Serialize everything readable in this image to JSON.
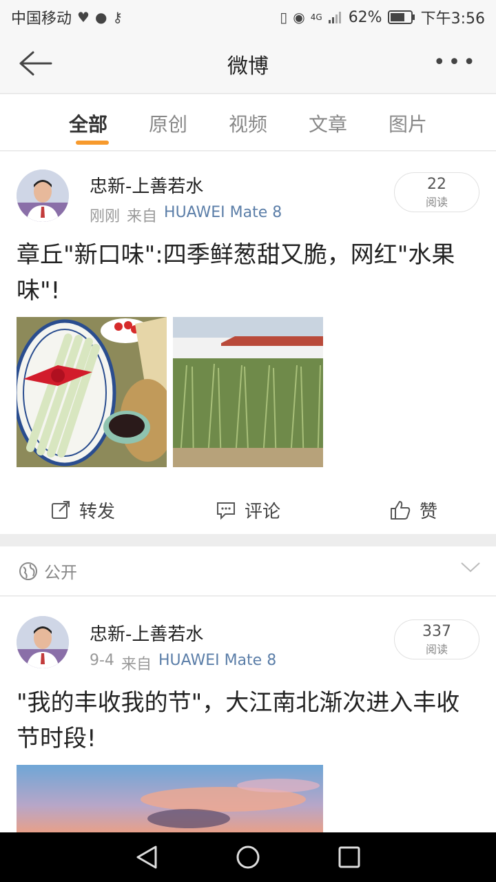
{
  "status_bar": {
    "carrier": "中国移动",
    "network": "4G",
    "battery": "62%",
    "time": "下午3:56"
  },
  "header": {
    "title": "微博"
  },
  "tabs": [
    {
      "label": "全部",
      "active": true
    },
    {
      "label": "原创",
      "active": false
    },
    {
      "label": "视频",
      "active": false
    },
    {
      "label": "文章",
      "active": false
    },
    {
      "label": "图片",
      "active": false
    }
  ],
  "posts": [
    {
      "user": "忠新-上善若水",
      "time": "刚刚",
      "from_label": "来自",
      "device": "HUAWEI Mate 8",
      "reads": "22",
      "reads_label": "阅读",
      "text": "章丘\"新口味\":四季鲜葱甜又脆，网红\"水果味\"!",
      "images": [
        "scallion-plate-photo",
        "scallion-field-photo"
      ],
      "actions": {
        "repost": "转发",
        "comment": "评论",
        "like": "赞"
      },
      "visibility": "公开"
    },
    {
      "user": "忠新-上善若水",
      "time": "9-4",
      "from_label": "来自",
      "device": "HUAWEI Mate 8",
      "reads": "337",
      "reads_label": "阅读",
      "text": "\"我的丰收我的节\"，大江南北渐次进入丰收节时段!",
      "images": [
        "sunset-sky-photo"
      ]
    }
  ],
  "colors": {
    "accent": "#f79a2d",
    "link": "#5b7ea8",
    "nav_bar": "#000000"
  }
}
